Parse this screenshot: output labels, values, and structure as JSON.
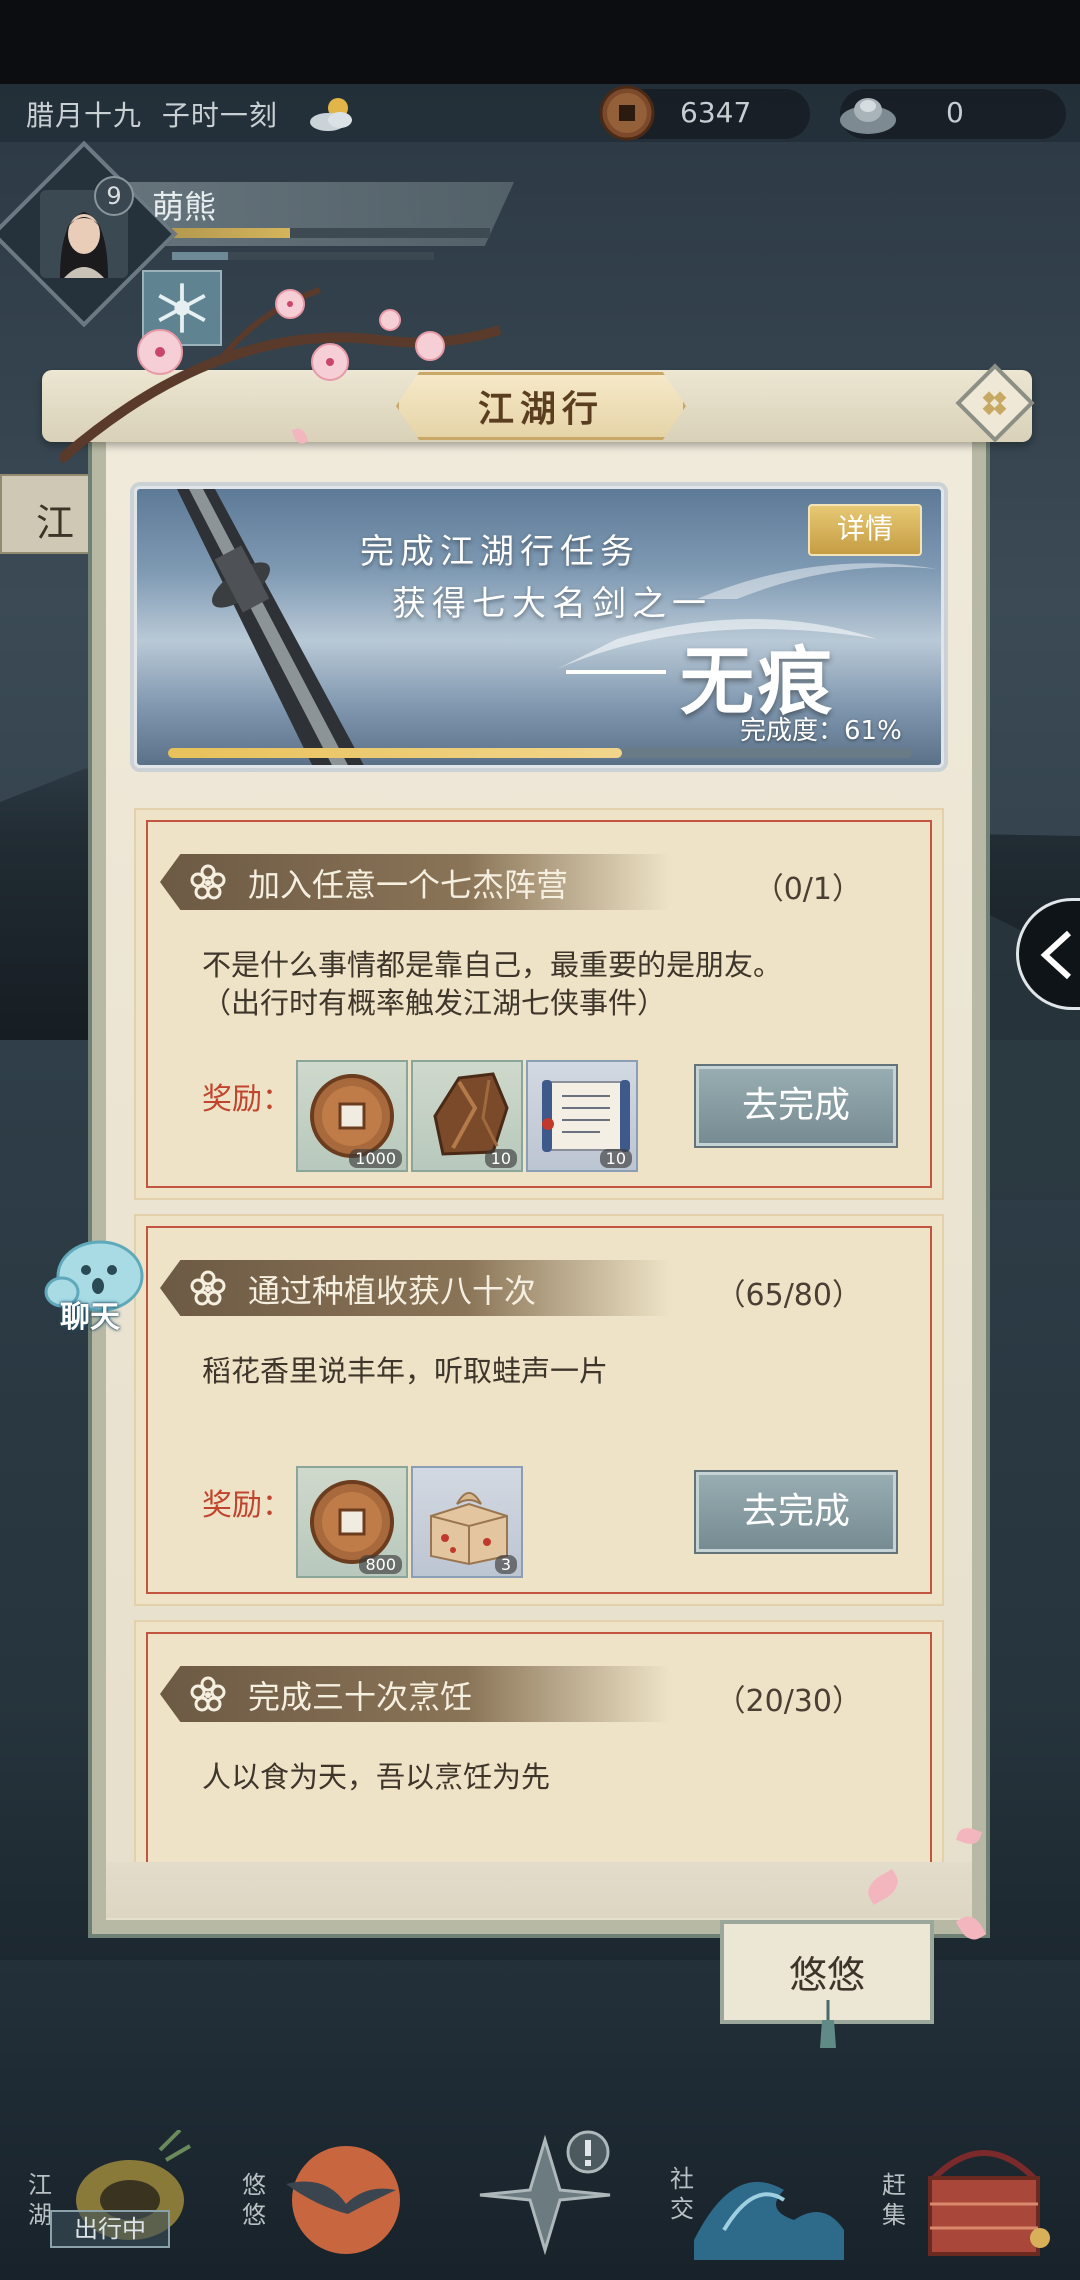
{
  "status_bar": {
    "date": "腊月十九",
    "time": "子时一刻",
    "weather_icon": "cloudy-sun-icon",
    "coins": "6347",
    "silver": "0"
  },
  "player": {
    "level": "9",
    "name": "萌熊"
  },
  "side_tab_left": "江",
  "panel": {
    "title": "江湖行",
    "banner": {
      "line1": "完成江湖行任务",
      "line2": "获得七大名剑之一",
      "sword_name": "无痕",
      "detail_label": "详情",
      "progress_label": "完成度：61%",
      "progress": 0.61
    },
    "reward_label": "奖励：",
    "tasks": [
      {
        "title": "加入任意一个七杰阵营",
        "count": "（0/1）",
        "desc_line1": "不是什么事情都是靠自己，最重要的是朋友。",
        "desc_line2": "（出行时有概率触发江湖七侠事件）",
        "rewards": [
          {
            "icon": "copper-coin-icon",
            "qty": "1000"
          },
          {
            "icon": "ore-stone-icon",
            "qty": "10"
          },
          {
            "icon": "scroll-icon",
            "qty": "10"
          }
        ],
        "button": "去完成"
      },
      {
        "title": "通过种植收获八十次",
        "count": "（65/80）",
        "desc_line1": "稻花香里说丰年，听取蛙声一片",
        "desc_line2": "",
        "rewards": [
          {
            "icon": "copper-coin-icon",
            "qty": "800"
          },
          {
            "icon": "gift-package-icon",
            "qty": "3"
          }
        ],
        "button": "去完成"
      },
      {
        "title": "完成三十次烹饪",
        "count": "（20/30）",
        "desc_line1": "人以食为天，吾以烹饪为先",
        "desc_line2": "",
        "rewards": [],
        "button": ""
      }
    ]
  },
  "chat_label": "聊天",
  "companion_tab": "悠悠",
  "bottom_nav": {
    "jianghu": "江湖",
    "traveling_badge": "出行中",
    "youyou": "悠悠",
    "social": "社交",
    "market": "赶集"
  },
  "colors": {
    "accent_gold": "#c59d44",
    "reward_red": "#c0442e",
    "button_teal": "#768c92"
  }
}
